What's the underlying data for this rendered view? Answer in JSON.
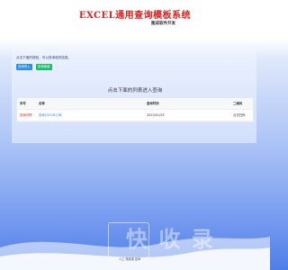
{
  "header": {
    "title": "EXCEL通用查询模板系统",
    "subtitle": "图成软件开发"
  },
  "main": {
    "notice": "点击下面的按钮，可以查询相关信息。",
    "buttons": [
      "查询导入",
      "查询新增"
    ],
    "section_title": "点击下面的列表进入查询",
    "table": {
      "headers": [
        "序号",
        "名称",
        "查询时间",
        "二维码"
      ],
      "rows": [
        {
          "no": "查询详情",
          "name": "查询2022年订单",
          "time": "2023/01/25",
          "qr": "点击扫码"
        }
      ]
    }
  },
  "watermark": {
    "text": "快 收 录",
    "sub": "人工 快收录 技术"
  },
  "colors": {
    "title_red": "#e11d1d",
    "primary_blue": "#2d8cf0",
    "success_green": "#19be6b",
    "background_blue": "#6e95ee"
  }
}
